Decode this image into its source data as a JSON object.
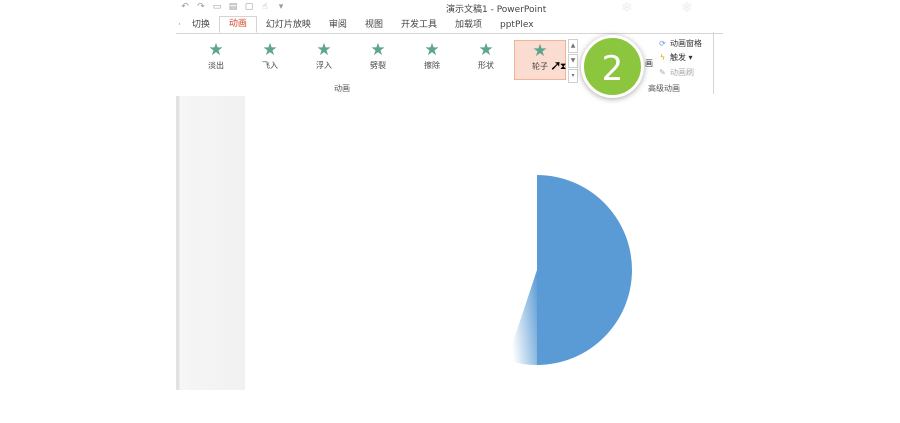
{
  "window_title": "演示文稿1 - PowerPoint",
  "tabs": {
    "lead_sep": "·",
    "t1": "切换",
    "t2": "动画",
    "t3": "幻灯片放映",
    "t4": "审阅",
    "t5": "视图",
    "t6": "开发工具",
    "t7": "加载项",
    "t8": "pptPlex"
  },
  "animations": {
    "a1": "淡出",
    "a2": "飞入",
    "a3": "浮入",
    "a4": "劈裂",
    "a5": "擦除",
    "a6": "形状",
    "a7": "轮子",
    "group_label": "动画"
  },
  "advanced": {
    "pane": "动画窗格",
    "trigger": "触发 ▾",
    "painter": "动画刷",
    "group_label": "高级动画",
    "partial": "画"
  },
  "step_badge": "2",
  "colors": {
    "accent_tab": "#d24726",
    "star_green": "#5ea58c",
    "selected_bg": "#fbdcd0",
    "badge_green": "#8cc63f",
    "pie_blue": "#5b9bd5"
  },
  "icons": {
    "star": "★",
    "cursor": "➚",
    "hourglass": "⧗"
  }
}
